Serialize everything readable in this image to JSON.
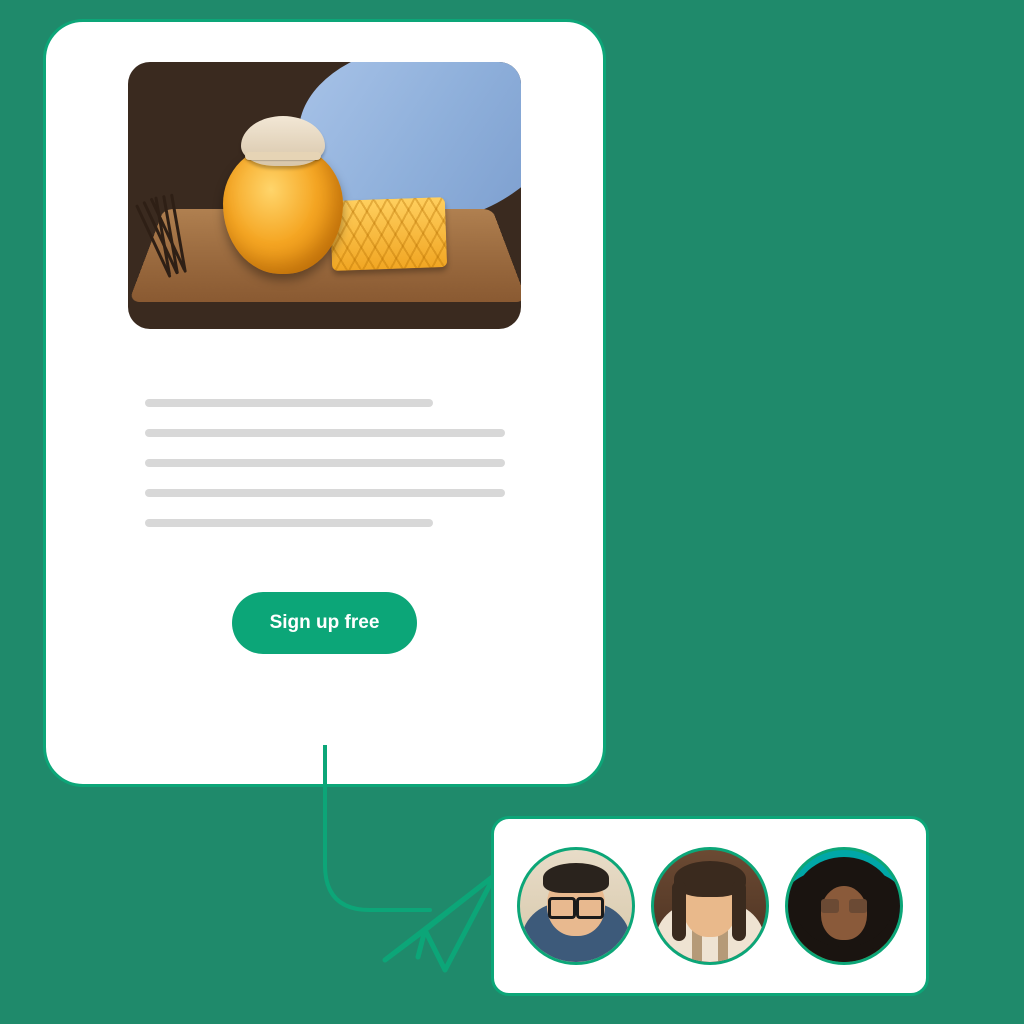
{
  "card": {
    "image_alt": "honey-jar-on-wooden-board",
    "cta_label": "Sign up free"
  },
  "subscribers": {
    "avatars": [
      "person-1",
      "person-2",
      "person-3"
    ]
  },
  "colors": {
    "brand": "#0ca678",
    "background": "#1f8a6b"
  }
}
